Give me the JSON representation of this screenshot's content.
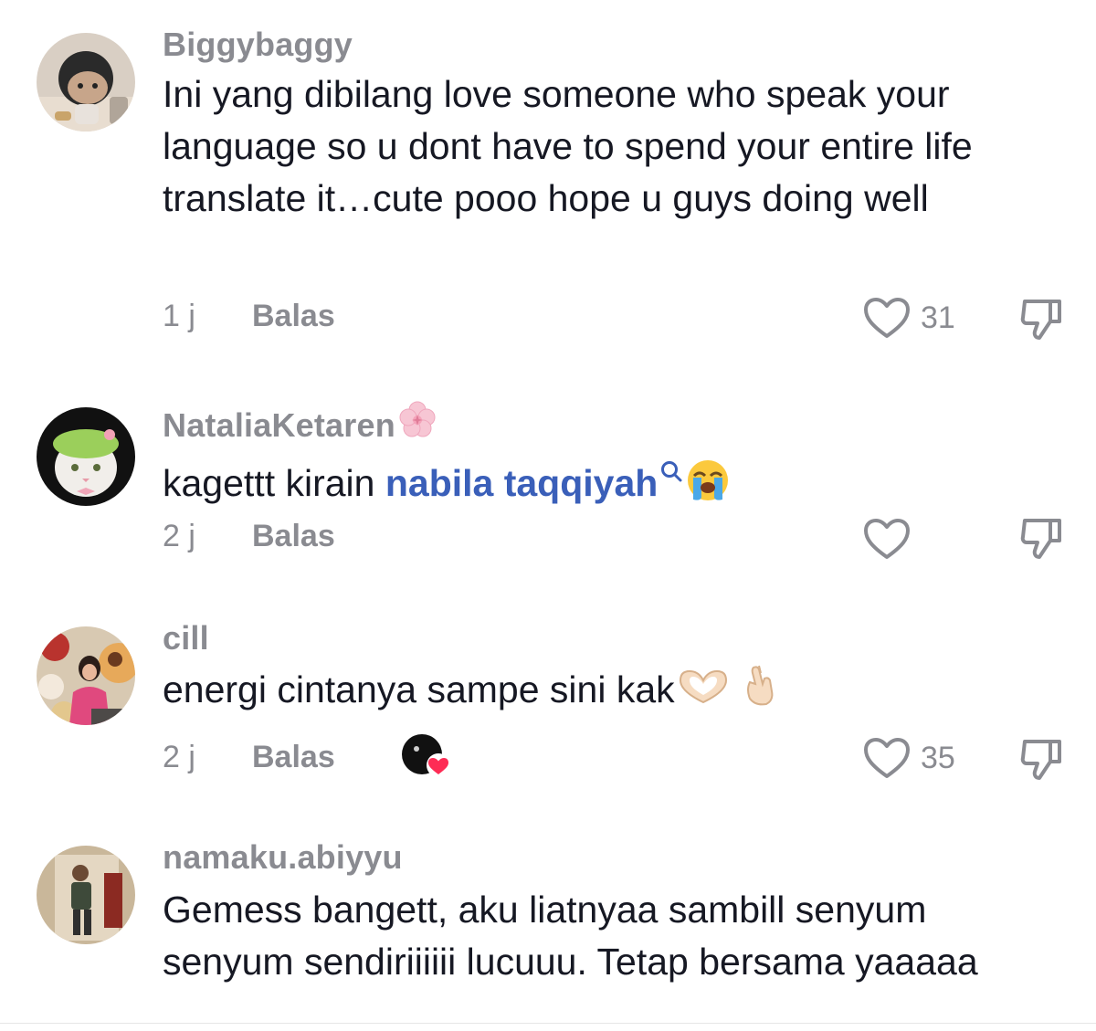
{
  "comments": [
    {
      "username": "Biggybaggy",
      "text": "Ini yang dibilang love someone who speak your language so u dont have to spend your entire life translate it…cute pooo hope u guys doing well",
      "time": "1 j",
      "reply_label": "Balas",
      "likes": "31",
      "avatar": "toy-figure-avatar"
    },
    {
      "username": "NataliaKetaren",
      "username_emoji": "cherry-blossom-emoji",
      "text_before": "kagettt kirain ",
      "mention": "nabila taqqiyah",
      "mention_icon": "search-icon",
      "text_emoji": "loudly-crying-face-emoji",
      "time": "2 j",
      "reply_label": "Balas",
      "likes": "",
      "avatar": "cat-with-hat-avatar"
    },
    {
      "username": "cill",
      "text": "energi cintanya sampe sini kak",
      "text_emojis": [
        "heart-hands-emoji",
        "finger-heart-emoji"
      ],
      "time": "2 j",
      "reply_label": "Balas",
      "likes": "35",
      "creator_liked": true,
      "avatar": "woman-flowers-avatar"
    },
    {
      "username": "namaku.abiyyu",
      "text": "Gemess bangett, aku liatnyaa sambill senyum senyum sendiriiiiii lucuuu. Tetap bersama yaaaaa",
      "avatar": "person-mirror-avatar"
    }
  ],
  "colors": {
    "username": "#8a8b91",
    "text": "#161823",
    "mention": "#3a5fb9",
    "like_heart_red": "#fe2c55"
  }
}
